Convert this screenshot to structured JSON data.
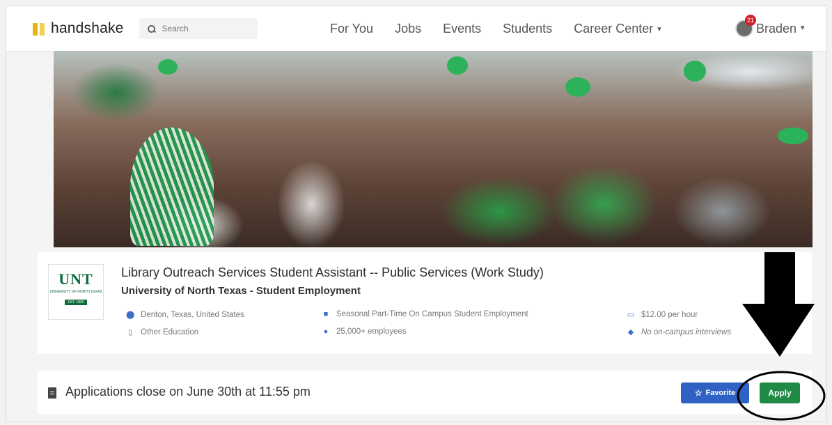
{
  "nav": {
    "logo_text": "handshake",
    "search_placeholder": "Search",
    "links": [
      "For You",
      "Jobs",
      "Events",
      "Students",
      "Career Center"
    ],
    "career_center_caret": "▾",
    "user_name": "Braden",
    "user_caret": "▾",
    "notification_count": "21"
  },
  "job": {
    "logo": {
      "name": "UNT",
      "subtitle": "UNIVERSITY OF NORTH TEXAS",
      "est": "EST. 1890"
    },
    "title": "Library Outreach Services Student Assistant -- Public Services (Work Study)",
    "employer": "University of North Texas - Student Employment",
    "location": "Denton, Texas, United States",
    "job_type": "Seasonal Part-Time On Campus Student Employment",
    "pay": "$12.00 per hour",
    "category": "Other Education",
    "employees": "25,000+ employees",
    "interviews": "No on-campus interviews"
  },
  "actions": {
    "close_notice": "Applications close on June 30th at 11:55 pm",
    "favorite_label": "Favorite",
    "apply_label": "Apply"
  },
  "colors": {
    "apply_green": "#1e8a45",
    "favorite_blue": "#2f62c4",
    "unt_green": "#0b6b3a",
    "badge_red": "#d0202c"
  }
}
